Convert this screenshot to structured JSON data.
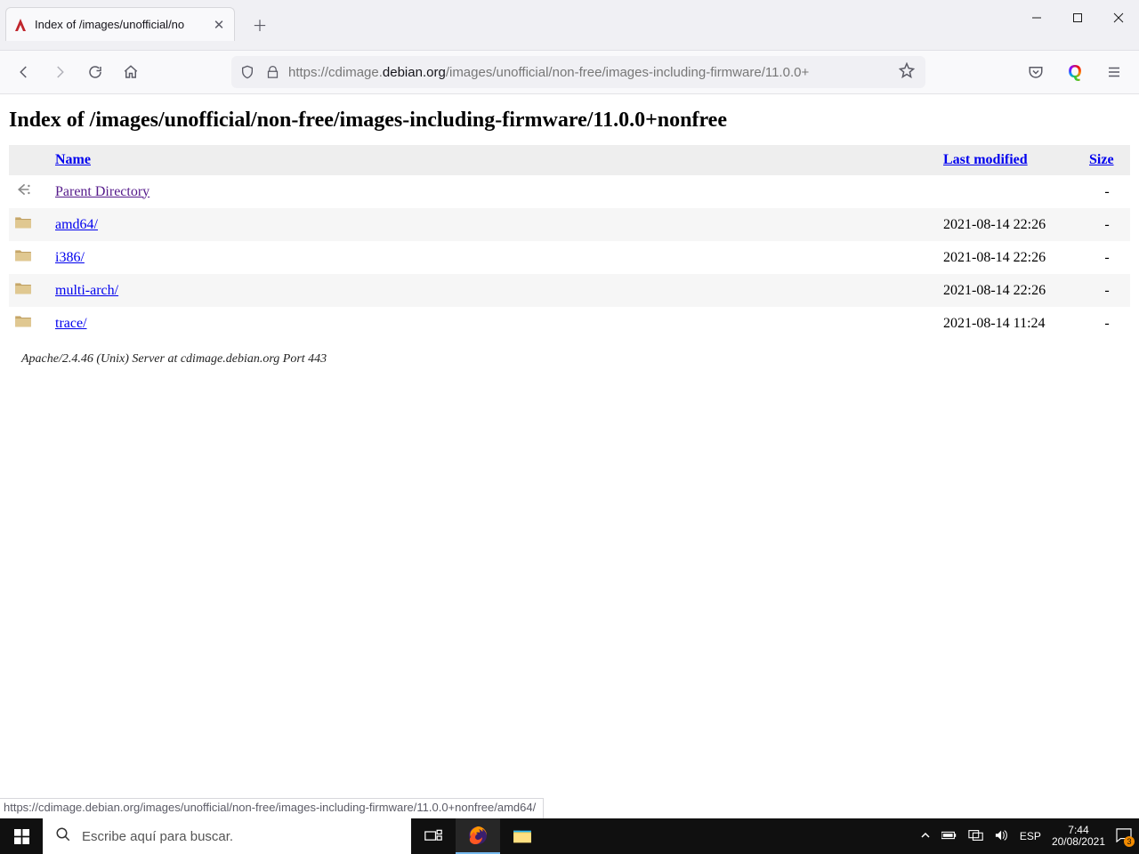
{
  "window": {
    "tab_title": "Index of /images/unofficial/no",
    "minimize": "–",
    "maximize": "▢",
    "close": "✕"
  },
  "url": {
    "scheme": "https://",
    "subdomain": "cdimage.",
    "domain": "debian.org",
    "path": "/images/unofficial/non-free/images-including-firmware/11.0.0+"
  },
  "page": {
    "heading": "Index of /images/unofficial/non-free/images-including-firmware/11.0.0+nonfree",
    "columns": {
      "name": "Name",
      "modified": "Last modified",
      "size": "Size"
    },
    "rows": [
      {
        "icon": "back",
        "name": "Parent Directory",
        "visited": true,
        "date": "",
        "size": "-"
      },
      {
        "icon": "folder",
        "name": "amd64/",
        "date": "2021-08-14 22:26",
        "size": "-"
      },
      {
        "icon": "folder",
        "name": "i386/",
        "date": "2021-08-14 22:26",
        "size": "-"
      },
      {
        "icon": "folder",
        "name": "multi-arch/",
        "date": "2021-08-14 22:26",
        "size": "-"
      },
      {
        "icon": "folder",
        "name": "trace/",
        "date": "2021-08-14 11:24",
        "size": "-"
      }
    ],
    "footer": "Apache/2.4.46 (Unix) Server at cdimage.debian.org Port 443"
  },
  "status": "https://cdimage.debian.org/images/unofficial/non-free/images-including-firmware/11.0.0+nonfree/amd64/",
  "taskbar": {
    "search_placeholder": "Escribe aquí para buscar.",
    "lang": "ESP",
    "time": "7:44",
    "date": "20/08/2021",
    "notif_count": "3"
  }
}
